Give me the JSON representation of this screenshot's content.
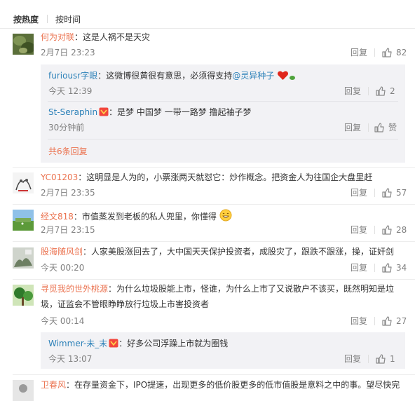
{
  "sort": {
    "hot": "按热度",
    "time": "按时间"
  },
  "actions": {
    "reply": "回复"
  },
  "comments": [
    {
      "user": "何为对联",
      "text": "：这是人祸不是天灾",
      "time": "2月7日 23:23",
      "likes": "82",
      "replies": [
        {
          "user": "furiousr字眼",
          "text": "：这微博很黄很有意思，必须得支持",
          "mention": "@灵异种子",
          "time": "今天 12:39",
          "likes": "2"
        },
        {
          "user": "St-Seraphin",
          "text": "：是梦 中国梦 一带一路梦 撸起袖子梦",
          "time": "30分钟前",
          "likes": "赞"
        }
      ],
      "more": "共6条回复"
    },
    {
      "user": "YC01203",
      "text": "：这明显是人为的，小票涨两天就怼它：炒作概念。把资金人为往国企大盘里赶",
      "time": "2月7日 23:35",
      "likes": "57"
    },
    {
      "user": "经文818",
      "text": "：市值蒸发到老板的私人兜里，你懂得",
      "time": "2月7日 23:15",
      "likes": "28"
    },
    {
      "user": "股海随风剑",
      "text": "：人家美股涨回去了，大中国天天保护投资者，成股灾了，跟跌不跟涨，操，证奸剑",
      "time": "今天 00:20",
      "likes": "34"
    },
    {
      "user": "寻觅我的世外桃源",
      "text": "：为什么垃圾股能上市，怪谁，为什么上市了又说散户不该买，既然明知是垃圾，证监会不管眼睁睁放行垃圾上市害投资者",
      "time": "今天 00:14",
      "likes": "27",
      "replies": [
        {
          "user": "Wimmer-未_末",
          "text": "：好多公司浮躁上市就为圈钱",
          "time": "今天 13:07",
          "likes": "1"
        }
      ]
    },
    {
      "user": "卫春风",
      "text": "：在存量资金下，IPO提速，出现更多的低价股更多的低市值股是意料之中的事。望尽快完"
    }
  ]
}
